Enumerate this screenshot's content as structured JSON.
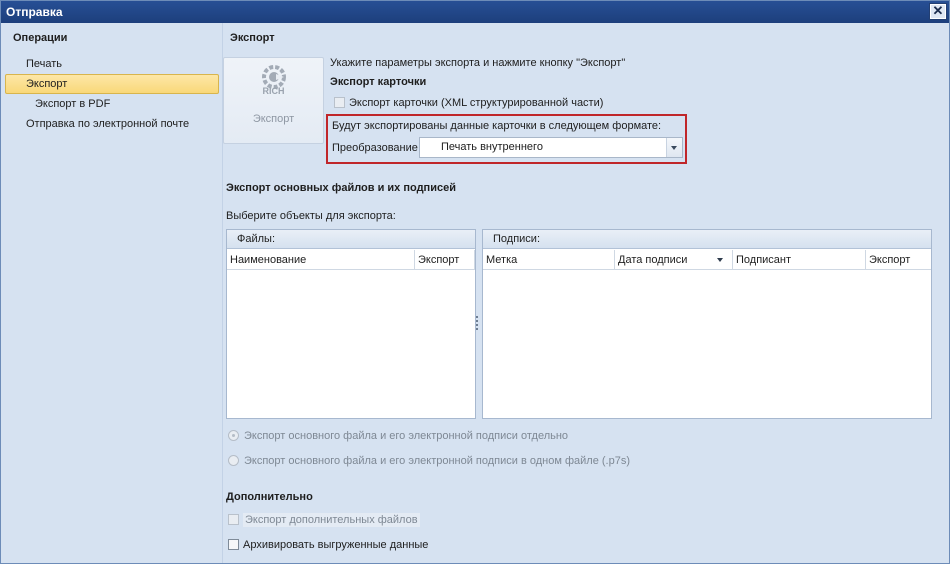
{
  "window": {
    "title": "Отправка",
    "close_glyph": "✕"
  },
  "sidebar": {
    "title": "Операции",
    "items": [
      {
        "label": "Печать"
      },
      {
        "label": "Экспорт"
      },
      {
        "label": "Экспорт в PDF"
      },
      {
        "label": "Отправка по электронной почте"
      }
    ]
  },
  "main": {
    "title": "Экспорт",
    "export_button": {
      "label": "Экспорт",
      "logo_text": "RICH"
    },
    "instructions": "Укажите параметры экспорта и нажмите кнопку \"Экспорт\"",
    "card_section": {
      "title": "Экспорт карточки",
      "checkbox_label": "Экспорт карточки (XML структурированной части)",
      "format_note": "Будут экспортированы данные карточки в следующем формате:",
      "transform_label": "Преобразование",
      "transform_value": "Печать внутреннего"
    },
    "files_section": {
      "title": "Экспорт основных файлов и их подписей",
      "select_label": "Выберите объекты для экспорта:",
      "files_panel": {
        "title": "Файлы:",
        "columns": [
          "Наименование",
          "Экспорт"
        ]
      },
      "signatures_panel": {
        "title": "Подписи:",
        "columns": [
          "Метка",
          "Дата подписи",
          "Подписант",
          "Экспорт"
        ]
      },
      "radio_options": [
        {
          "label": "Экспорт основного файла и его электронной подписи отдельно",
          "checked": true
        },
        {
          "label": "Экспорт основного файла и его электронной подписи в одном файле (.p7s)",
          "checked": false
        }
      ]
    },
    "extra_section": {
      "title": "Дополнительно",
      "extra_files_label": "Экспорт дополнительных  файлов",
      "archive_label": "Архивировать выгруженные данные"
    }
  },
  "colors": {
    "accent": "#1d3f7c",
    "highlight_border": "#c0262a",
    "selection": "#f9d879"
  }
}
